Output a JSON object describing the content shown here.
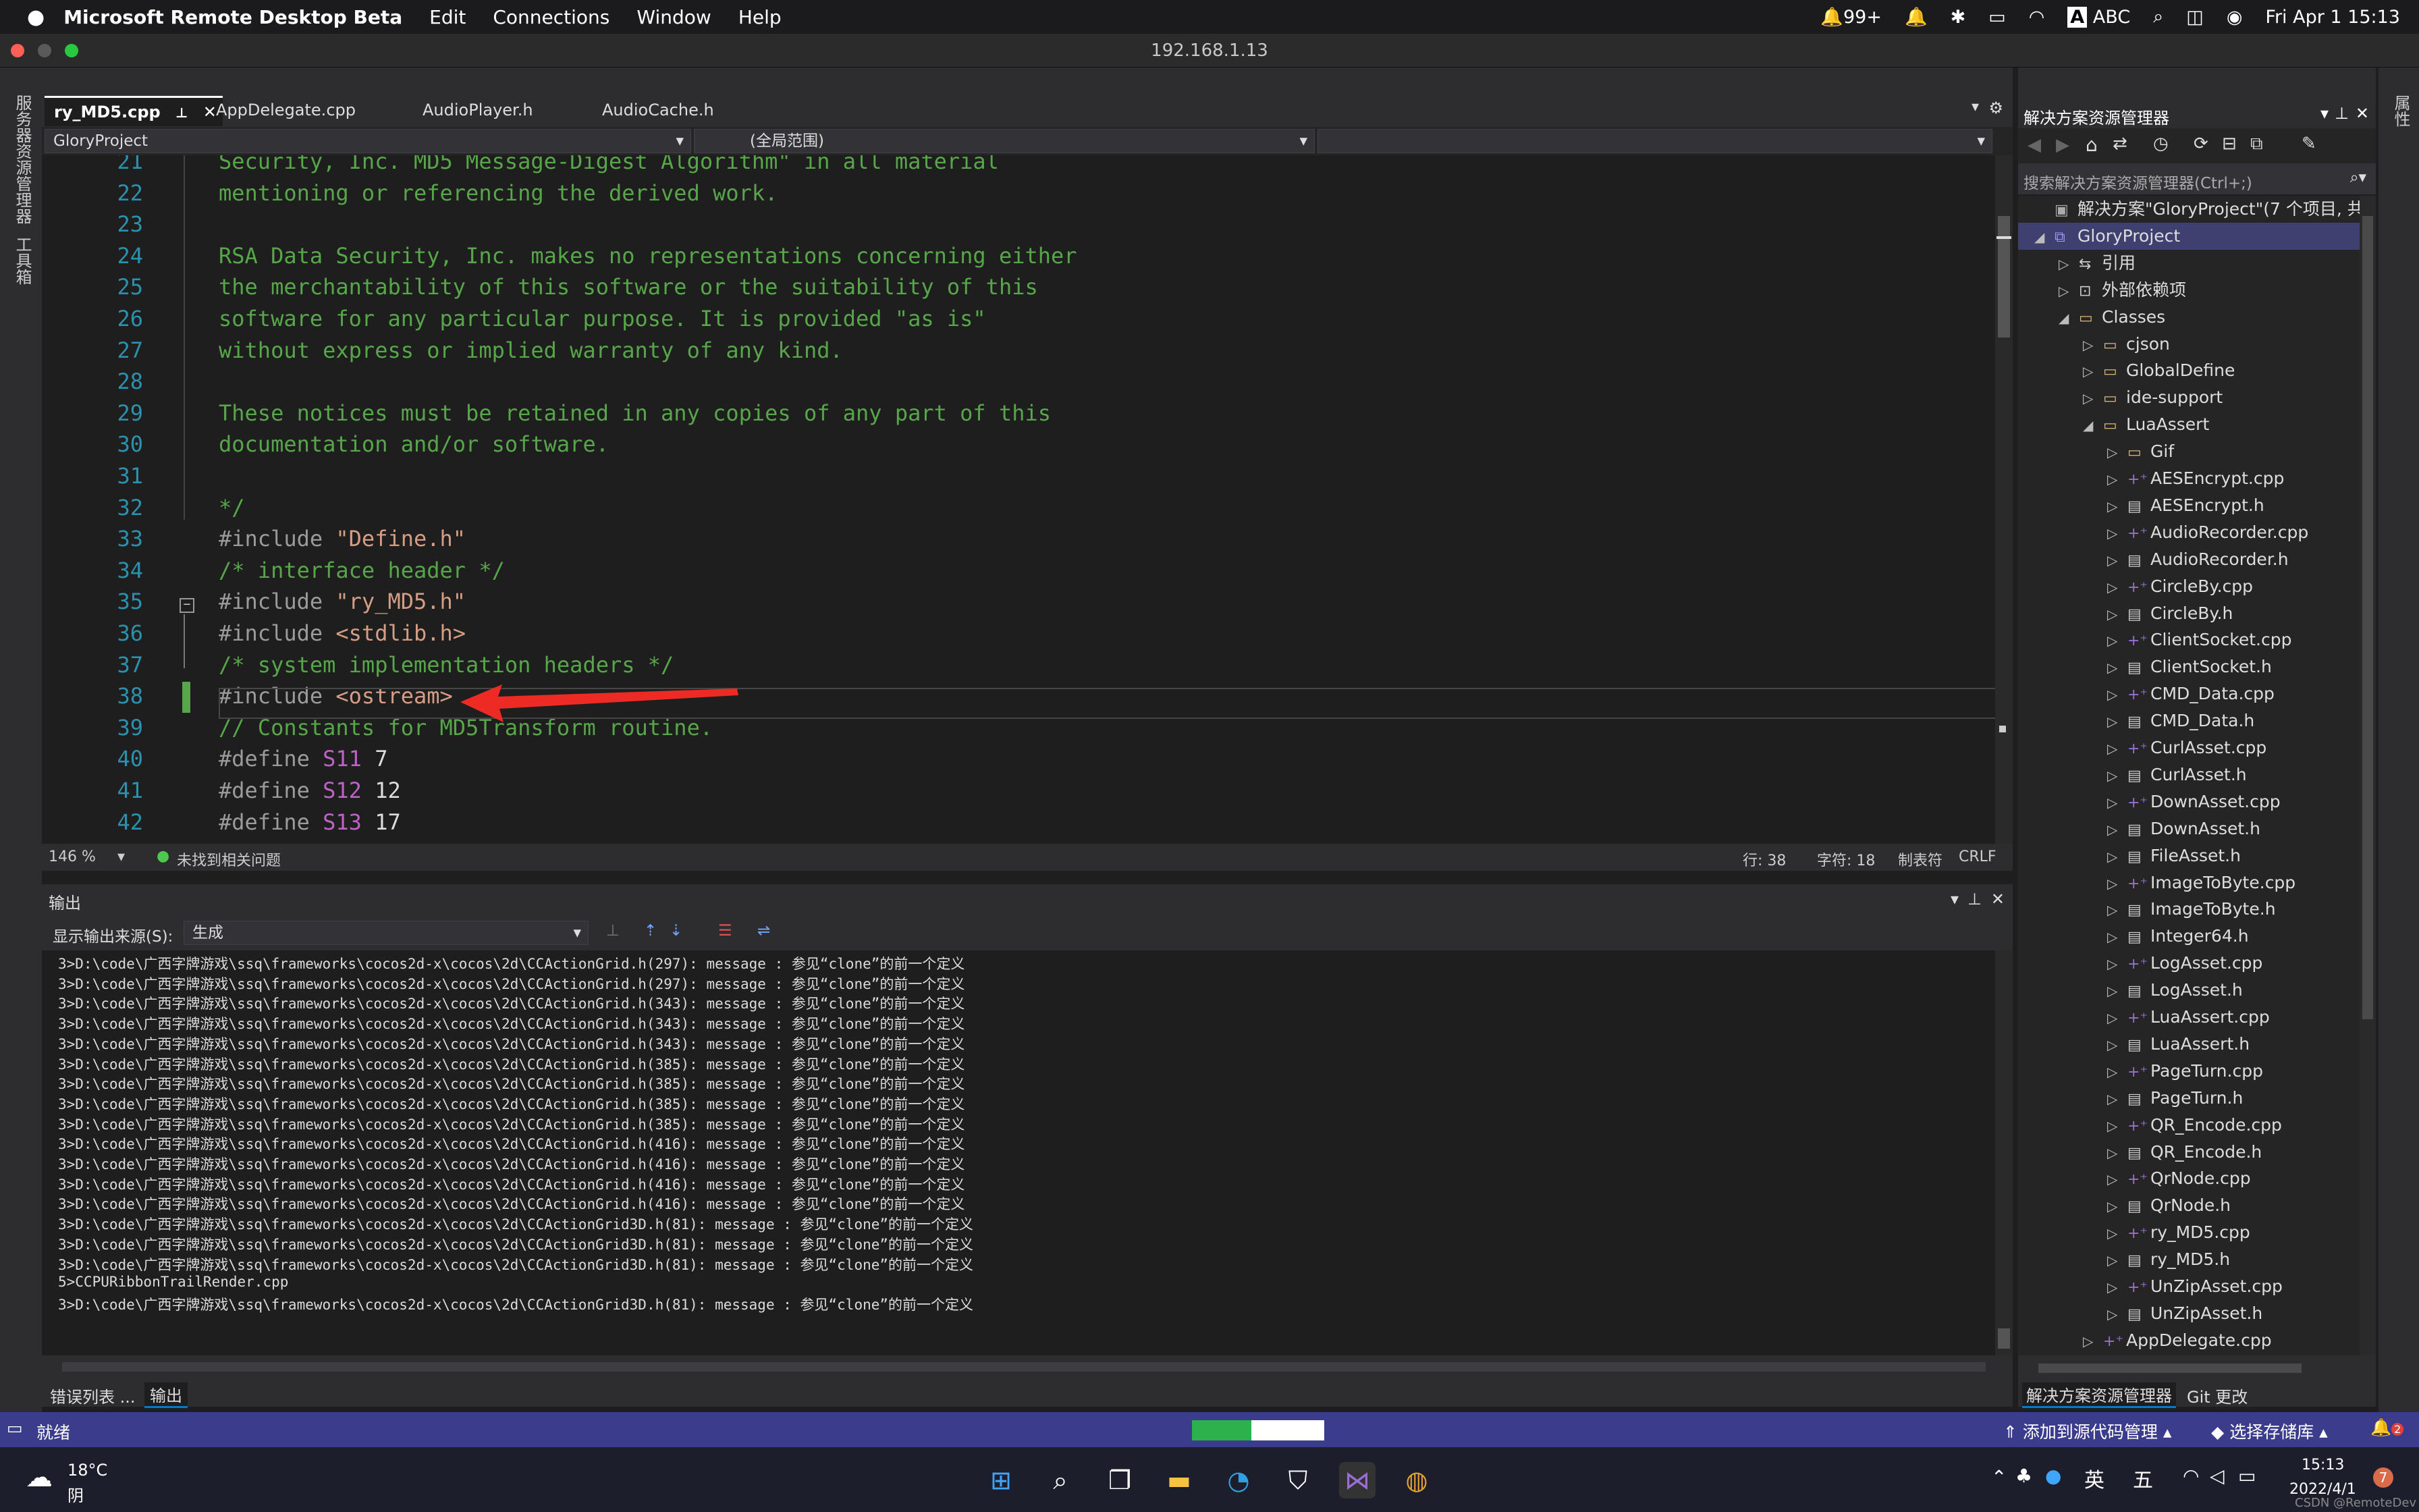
{
  "mac_menubar": {
    "app_name": "Microsoft Remote Desktop Beta",
    "menus": [
      "Edit",
      "Connections",
      "Window",
      "Help"
    ],
    "notif_count": "99+",
    "input_method": "ABC",
    "datetime": "Fri Apr 1  15:13"
  },
  "window": {
    "title": "192.168.1.13"
  },
  "left_toolbar": [
    "服务器资源管理器",
    "工具箱"
  ],
  "editor": {
    "tabs": [
      "ry_MD5.cpp",
      "AppDelegate.cpp",
      "AudioPlayer.h",
      "AudioCache.h"
    ],
    "project_combo": "GloryProject",
    "scope_combo": "(全局范围)",
    "lines": [
      {
        "n": "21",
        "t": "Security, Inc. MD5 Message-Digest Algorithm\" in all material"
      },
      {
        "n": "22",
        "t": "mentioning or referencing the derived work."
      },
      {
        "n": "23",
        "t": ""
      },
      {
        "n": "24",
        "t": "RSA Data Security, Inc. makes no representations concerning either"
      },
      {
        "n": "25",
        "t": "the merchantability of this software or the suitability of this"
      },
      {
        "n": "26",
        "t": "software for any particular purpose. It is provided \"as is\""
      },
      {
        "n": "27",
        "t": "without express or implied warranty of any kind."
      },
      {
        "n": "28",
        "t": ""
      },
      {
        "n": "29",
        "t": "These notices must be retained in any copies of any part of this"
      },
      {
        "n": "30",
        "t": "documentation and/or software."
      },
      {
        "n": "31",
        "t": ""
      },
      {
        "n": "32",
        "t": "*/"
      },
      {
        "n": "33",
        "t": "#include \"Define.h\""
      },
      {
        "n": "34",
        "t": "/* interface header */"
      },
      {
        "n": "35",
        "t": "#include \"ry_MD5.h\""
      },
      {
        "n": "36",
        "t": "#include <stdlib.h>"
      },
      {
        "n": "37",
        "t": "/* system implementation headers */"
      },
      {
        "n": "38",
        "t": "#include <ostream>"
      },
      {
        "n": "39",
        "t": "// Constants for MD5Transform routine."
      },
      {
        "n": "40",
        "t": "#define S11 7"
      },
      {
        "n": "41",
        "t": "#define S12 12"
      },
      {
        "n": "42",
        "t": "#define S13 17"
      }
    ],
    "status": {
      "zoom": "146 %",
      "issues": "未找到相关问题",
      "line": "行: 38",
      "char": "字符: 18",
      "tab": "制表符",
      "eol": "CRLF"
    }
  },
  "output": {
    "title": "输出",
    "source_label": "显示输出来源(S):",
    "source_value": "生成",
    "lines": [
      "3>D:\\code\\广西字牌游戏\\ssq\\frameworks\\cocos2d-x\\cocos\\2d\\CCActionGrid.h(297): message : 参见“clone”的前一个定义",
      "3>D:\\code\\广西字牌游戏\\ssq\\frameworks\\cocos2d-x\\cocos\\2d\\CCActionGrid.h(297): message : 参见“clone”的前一个定义",
      "3>D:\\code\\广西字牌游戏\\ssq\\frameworks\\cocos2d-x\\cocos\\2d\\CCActionGrid.h(343): message : 参见“clone”的前一个定义",
      "3>D:\\code\\广西字牌游戏\\ssq\\frameworks\\cocos2d-x\\cocos\\2d\\CCActionGrid.h(343): message : 参见“clone”的前一个定义",
      "3>D:\\code\\广西字牌游戏\\ssq\\frameworks\\cocos2d-x\\cocos\\2d\\CCActionGrid.h(343): message : 参见“clone”的前一个定义",
      "3>D:\\code\\广西字牌游戏\\ssq\\frameworks\\cocos2d-x\\cocos\\2d\\CCActionGrid.h(385): message : 参见“clone”的前一个定义",
      "3>D:\\code\\广西字牌游戏\\ssq\\frameworks\\cocos2d-x\\cocos\\2d\\CCActionGrid.h(385): message : 参见“clone”的前一个定义",
      "3>D:\\code\\广西字牌游戏\\ssq\\frameworks\\cocos2d-x\\cocos\\2d\\CCActionGrid.h(385): message : 参见“clone”的前一个定义",
      "3>D:\\code\\广西字牌游戏\\ssq\\frameworks\\cocos2d-x\\cocos\\2d\\CCActionGrid.h(385): message : 参见“clone”的前一个定义",
      "3>D:\\code\\广西字牌游戏\\ssq\\frameworks\\cocos2d-x\\cocos\\2d\\CCActionGrid.h(416): message : 参见“clone”的前一个定义",
      "3>D:\\code\\广西字牌游戏\\ssq\\frameworks\\cocos2d-x\\cocos\\2d\\CCActionGrid.h(416): message : 参见“clone”的前一个定义",
      "3>D:\\code\\广西字牌游戏\\ssq\\frameworks\\cocos2d-x\\cocos\\2d\\CCActionGrid.h(416): message : 参见“clone”的前一个定义",
      "3>D:\\code\\广西字牌游戏\\ssq\\frameworks\\cocos2d-x\\cocos\\2d\\CCActionGrid.h(416): message : 参见“clone”的前一个定义",
      "3>D:\\code\\广西字牌游戏\\ssq\\frameworks\\cocos2d-x\\cocos\\2d\\CCActionGrid3D.h(81): message : 参见“clone”的前一个定义",
      "3>D:\\code\\广西字牌游戏\\ssq\\frameworks\\cocos2d-x\\cocos\\2d\\CCActionGrid3D.h(81): message : 参见“clone”的前一个定义",
      "3>D:\\code\\广西字牌游戏\\ssq\\frameworks\\cocos2d-x\\cocos\\2d\\CCActionGrid3D.h(81): message : 参见“clone”的前一个定义",
      "5>CCPURibbonTrailRender.cpp",
      "3>D:\\code\\广西字牌游戏\\ssq\\frameworks\\cocos2d-x\\cocos\\2d\\CCActionGrid3D.h(81): message : 参见“clone”的前一个定义"
    ],
    "bottom_tabs": [
      "错误列表 ...",
      "输出"
    ]
  },
  "solution_explorer": {
    "title": "解决方案资源管理器",
    "search_placeholder": "搜索解决方案资源管理器(Ctrl+;)",
    "items": [
      {
        "label": "解决方案\"GloryProject\"(7 个项目, 共 7",
        "depth": 0,
        "exp": "",
        "icon": "solution"
      },
      {
        "label": "GloryProject",
        "depth": 0,
        "exp": "◢",
        "icon": "project",
        "selected": true
      },
      {
        "label": "引用",
        "depth": 1,
        "exp": "▷",
        "icon": "ref"
      },
      {
        "label": "外部依赖项",
        "depth": 1,
        "exp": "▷",
        "icon": "deps"
      },
      {
        "label": "Classes",
        "depth": 1,
        "exp": "◢",
        "icon": "folder"
      },
      {
        "label": "cjson",
        "depth": 2,
        "exp": "▷",
        "icon": "folder"
      },
      {
        "label": "GlobalDefine",
        "depth": 2,
        "exp": "▷",
        "icon": "folder"
      },
      {
        "label": "ide-support",
        "depth": 2,
        "exp": "▷",
        "icon": "folder"
      },
      {
        "label": "LuaAssert",
        "depth": 2,
        "exp": "◢",
        "icon": "folder"
      },
      {
        "label": "Gif",
        "depth": 3,
        "exp": "▷",
        "icon": "folder"
      },
      {
        "label": "AESEncrypt.cpp",
        "depth": 3,
        "exp": "▷",
        "icon": "cpp"
      },
      {
        "label": "AESEncrypt.h",
        "depth": 3,
        "exp": "▷",
        "icon": "h"
      },
      {
        "label": "AudioRecorder.cpp",
        "depth": 3,
        "exp": "▷",
        "icon": "cpp"
      },
      {
        "label": "AudioRecorder.h",
        "depth": 3,
        "exp": "▷",
        "icon": "h"
      },
      {
        "label": "CircleBy.cpp",
        "depth": 3,
        "exp": "▷",
        "icon": "cpp"
      },
      {
        "label": "CircleBy.h",
        "depth": 3,
        "exp": "▷",
        "icon": "h"
      },
      {
        "label": "ClientSocket.cpp",
        "depth": 3,
        "exp": "▷",
        "icon": "cpp"
      },
      {
        "label": "ClientSocket.h",
        "depth": 3,
        "exp": "▷",
        "icon": "h"
      },
      {
        "label": "CMD_Data.cpp",
        "depth": 3,
        "exp": "▷",
        "icon": "cpp"
      },
      {
        "label": "CMD_Data.h",
        "depth": 3,
        "exp": "▷",
        "icon": "h"
      },
      {
        "label": "CurlAsset.cpp",
        "depth": 3,
        "exp": "▷",
        "icon": "cpp"
      },
      {
        "label": "CurlAsset.h",
        "depth": 3,
        "exp": "▷",
        "icon": "h"
      },
      {
        "label": "DownAsset.cpp",
        "depth": 3,
        "exp": "▷",
        "icon": "cpp"
      },
      {
        "label": "DownAsset.h",
        "depth": 3,
        "exp": "▷",
        "icon": "h"
      },
      {
        "label": "FileAsset.h",
        "depth": 3,
        "exp": "▷",
        "icon": "h"
      },
      {
        "label": "ImageToByte.cpp",
        "depth": 3,
        "exp": "▷",
        "icon": "cpp"
      },
      {
        "label": "ImageToByte.h",
        "depth": 3,
        "exp": "▷",
        "icon": "h"
      },
      {
        "label": "Integer64.h",
        "depth": 3,
        "exp": "▷",
        "icon": "h"
      },
      {
        "label": "LogAsset.cpp",
        "depth": 3,
        "exp": "▷",
        "icon": "cpp"
      },
      {
        "label": "LogAsset.h",
        "depth": 3,
        "exp": "▷",
        "icon": "h"
      },
      {
        "label": "LuaAssert.cpp",
        "depth": 3,
        "exp": "▷",
        "icon": "cpp"
      },
      {
        "label": "LuaAssert.h",
        "depth": 3,
        "exp": "▷",
        "icon": "h"
      },
      {
        "label": "PageTurn.cpp",
        "depth": 3,
        "exp": "▷",
        "icon": "cpp"
      },
      {
        "label": "PageTurn.h",
        "depth": 3,
        "exp": "▷",
        "icon": "h"
      },
      {
        "label": "QR_Encode.cpp",
        "depth": 3,
        "exp": "▷",
        "icon": "cpp"
      },
      {
        "label": "QR_Encode.h",
        "depth": 3,
        "exp": "▷",
        "icon": "h"
      },
      {
        "label": "QrNode.cpp",
        "depth": 3,
        "exp": "▷",
        "icon": "cpp"
      },
      {
        "label": "QrNode.h",
        "depth": 3,
        "exp": "▷",
        "icon": "h"
      },
      {
        "label": "ry_MD5.cpp",
        "depth": 3,
        "exp": "▷",
        "icon": "cpp"
      },
      {
        "label": "ry_MD5.h",
        "depth": 3,
        "exp": "▷",
        "icon": "h"
      },
      {
        "label": "UnZipAsset.cpp",
        "depth": 3,
        "exp": "▷",
        "icon": "cpp"
      },
      {
        "label": "UnZipAsset.h",
        "depth": 3,
        "exp": "▷",
        "icon": "h"
      },
      {
        "label": "AppDelegate.cpp",
        "depth": 2,
        "exp": "▷",
        "icon": "cpp"
      }
    ],
    "bottom_tabs": [
      "解决方案资源管理器",
      "Git 更改"
    ]
  },
  "right_toolbar": [
    "属性"
  ],
  "vs_status": {
    "ready": "就绪",
    "add_source_control": "添加到源代码管理",
    "select_repo": "选择存储库",
    "notif": "2"
  },
  "taskbar": {
    "weather_temp": "18°C",
    "weather_desc": "阴",
    "ime1": "英",
    "ime2": "五",
    "time": "15:13",
    "date": "2022/4/1",
    "badge": "7",
    "watermark": "CSDN @RemoteDev"
  }
}
